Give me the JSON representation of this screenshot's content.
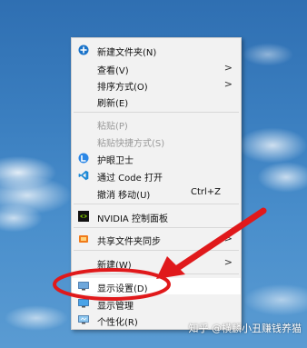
{
  "menu": {
    "items": [
      {
        "label": "新建文件夹(N)",
        "icon": "new-folder-icon"
      },
      {
        "label": "查看(V)"
      },
      {
        "label": "排序方式(O)"
      },
      {
        "label": "刷新(E)"
      },
      {
        "label": "粘贴(P)"
      },
      {
        "label": "粘贴快捷方式(S)"
      },
      {
        "label": "护眼卫士",
        "icon": "eye-guard-icon"
      },
      {
        "label": "通过 Code 打开",
        "icon": "vscode-icon"
      },
      {
        "label": "撤消 移动(U)",
        "shortcut": "Ctrl+Z"
      },
      {
        "label": "NVIDIA 控制面板",
        "icon": "nvidia-icon"
      },
      {
        "label": "共享文件夹同步",
        "icon": "sync-folder-icon"
      },
      {
        "label": "新建(W)"
      },
      {
        "label": "显示设置(D)",
        "icon": "display-icon"
      },
      {
        "label": "显示管理",
        "icon": "display-manager-icon"
      },
      {
        "label": "个性化(R)",
        "icon": "personalize-icon"
      }
    ],
    "chevron": ">"
  },
  "watermark": "知乎 @横麟小丑赚钱养猫",
  "colors": {
    "annotation": "#e0191b",
    "menu_bg": "#f2f2f2"
  }
}
